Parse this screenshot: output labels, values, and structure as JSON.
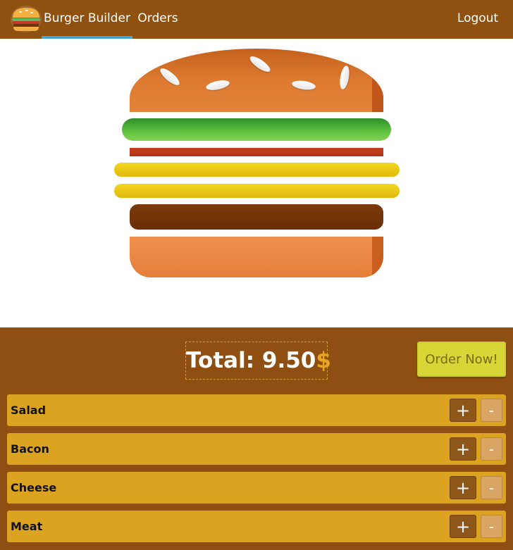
{
  "nav": {
    "logo_icon": "burger-logo-icon",
    "items": [
      {
        "label": "Burger Builder",
        "active": true
      },
      {
        "label": "Orders",
        "active": false
      }
    ],
    "logout_label": "Logout"
  },
  "burger": {
    "layers": [
      "bread-top",
      "salad",
      "bacon",
      "cheese",
      "cheese",
      "meat",
      "bread-bottom"
    ]
  },
  "build": {
    "total_label": "Total: 9.50",
    "currency_symbol": "$",
    "order_button_label": "Order Now!",
    "controls": [
      {
        "label": "Salad",
        "plus": "+",
        "minus": "-"
      },
      {
        "label": "Bacon",
        "plus": "+",
        "minus": "-"
      },
      {
        "label": "Cheese",
        "plus": "+",
        "minus": "-"
      },
      {
        "label": "Meat",
        "plus": "+",
        "minus": "-"
      }
    ]
  },
  "colors": {
    "header": "#8f5110",
    "active_indicator": "#3ea5d6",
    "controls_bg": "#8f4f12",
    "row_bg": "#dba320",
    "order_button": "#d8d537",
    "plus_button": "#8d571a",
    "minus_button": "#d8a562"
  }
}
